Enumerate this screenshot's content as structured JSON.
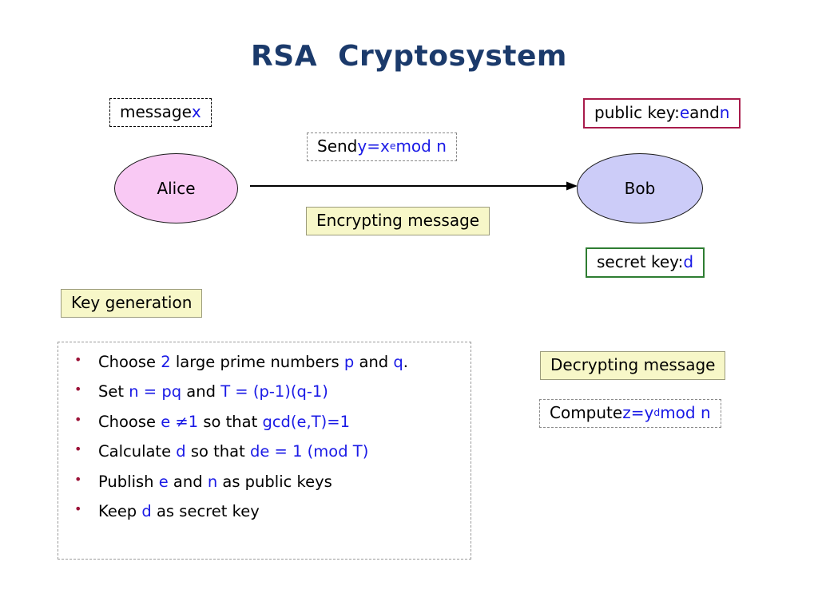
{
  "slide": {
    "title": "RSA  Cryptosystem"
  },
  "colors": {
    "title": "#1b3a6b",
    "variable_blue": "#1a1ae6",
    "bullet_maroon": "#9c1338",
    "alice_fill": "#f9c9f4",
    "bob_fill": "#ccccf8",
    "cream_fill": "#f7f7c8",
    "public_key_border": "#a81b4b",
    "secret_key_border": "#2e7d32"
  },
  "message_box": {
    "label": "message ",
    "variable": "x"
  },
  "public_key_box": {
    "label": "public key: ",
    "key_e": "e",
    "conjunction": " and ",
    "key_n": "n"
  },
  "send_box": {
    "label": "Send ",
    "lhs": "y",
    "equals": " = ",
    "base": "x",
    "exponent": "e",
    "modexpr": " mod n"
  },
  "actors": {
    "alice": "Alice",
    "bob": "Bob"
  },
  "encrypting_box": {
    "label": "Encrypting message"
  },
  "secret_key_box": {
    "label": "secret key: ",
    "key_d": "d"
  },
  "key_generation_box": {
    "label": "Key generation"
  },
  "key_generation_steps": [
    {
      "pre": "Choose ",
      "v1": "2",
      "mid": " large prime numbers ",
      "v2": "p",
      "mid2": " and ",
      "v3": "q",
      "post": "."
    },
    {
      "pre": "Set ",
      "v1": "n = pq",
      "mid": " and ",
      "v2": "T = (p-1)(q-1)",
      "mid2": "",
      "v3": "",
      "post": ""
    },
    {
      "pre": "Choose ",
      "v1": "e ≠1",
      "mid": " so that ",
      "v2": "gcd(e,T)=1",
      "mid2": "",
      "v3": "",
      "post": ""
    },
    {
      "pre": "Calculate ",
      "v1": "d",
      "mid": " so that ",
      "v2": "de = 1 (mod T)",
      "mid2": "",
      "v3": "",
      "post": ""
    },
    {
      "pre": "Publish ",
      "v1": "e",
      "mid": " and ",
      "v2": "n",
      "mid2": " as public keys",
      "v3": "",
      "post": ""
    },
    {
      "pre": "Keep ",
      "v1": "d",
      "mid": " as secret key",
      "v2": "",
      "mid2": "",
      "v3": "",
      "post": ""
    }
  ],
  "decrypting_box": {
    "label": "Decrypting message"
  },
  "compute_box": {
    "label": "Compute ",
    "lhs": "z",
    "equals": " = ",
    "base": "y",
    "exponent": "d",
    "modexpr": " mod n"
  }
}
